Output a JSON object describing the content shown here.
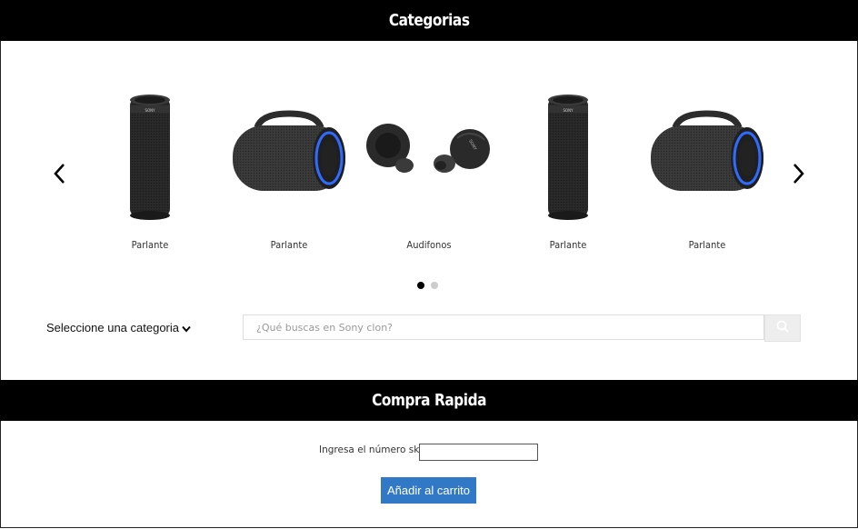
{
  "categories_section": {
    "title": "Categorias"
  },
  "carousel": {
    "items": [
      {
        "label": "Parlante",
        "image": "cylindrical-speaker"
      },
      {
        "label": "Parlante",
        "image": "barrel-speaker"
      },
      {
        "label": "Audifonos",
        "image": "earbuds"
      },
      {
        "label": "Parlante",
        "image": "cylindrical-speaker"
      },
      {
        "label": "Parlante",
        "image": "barrel-speaker"
      }
    ],
    "prev_icon": "chevron-left-icon",
    "next_icon": "chevron-right-icon",
    "page_count": 2,
    "active_page": 1
  },
  "search": {
    "category_label": "Seleccione una categoria",
    "placeholder": "¿Qué buscas en Sony clon?",
    "button_icon": "search-icon"
  },
  "quick_buy": {
    "title": "Compra Rapida",
    "sku_label": "Ingresa el número sku",
    "sku_value": "",
    "add_button": "Añadir al carrito"
  },
  "colors": {
    "bar": "#000000",
    "button": "#3178c6",
    "accent_ring": "#2f6bff"
  }
}
